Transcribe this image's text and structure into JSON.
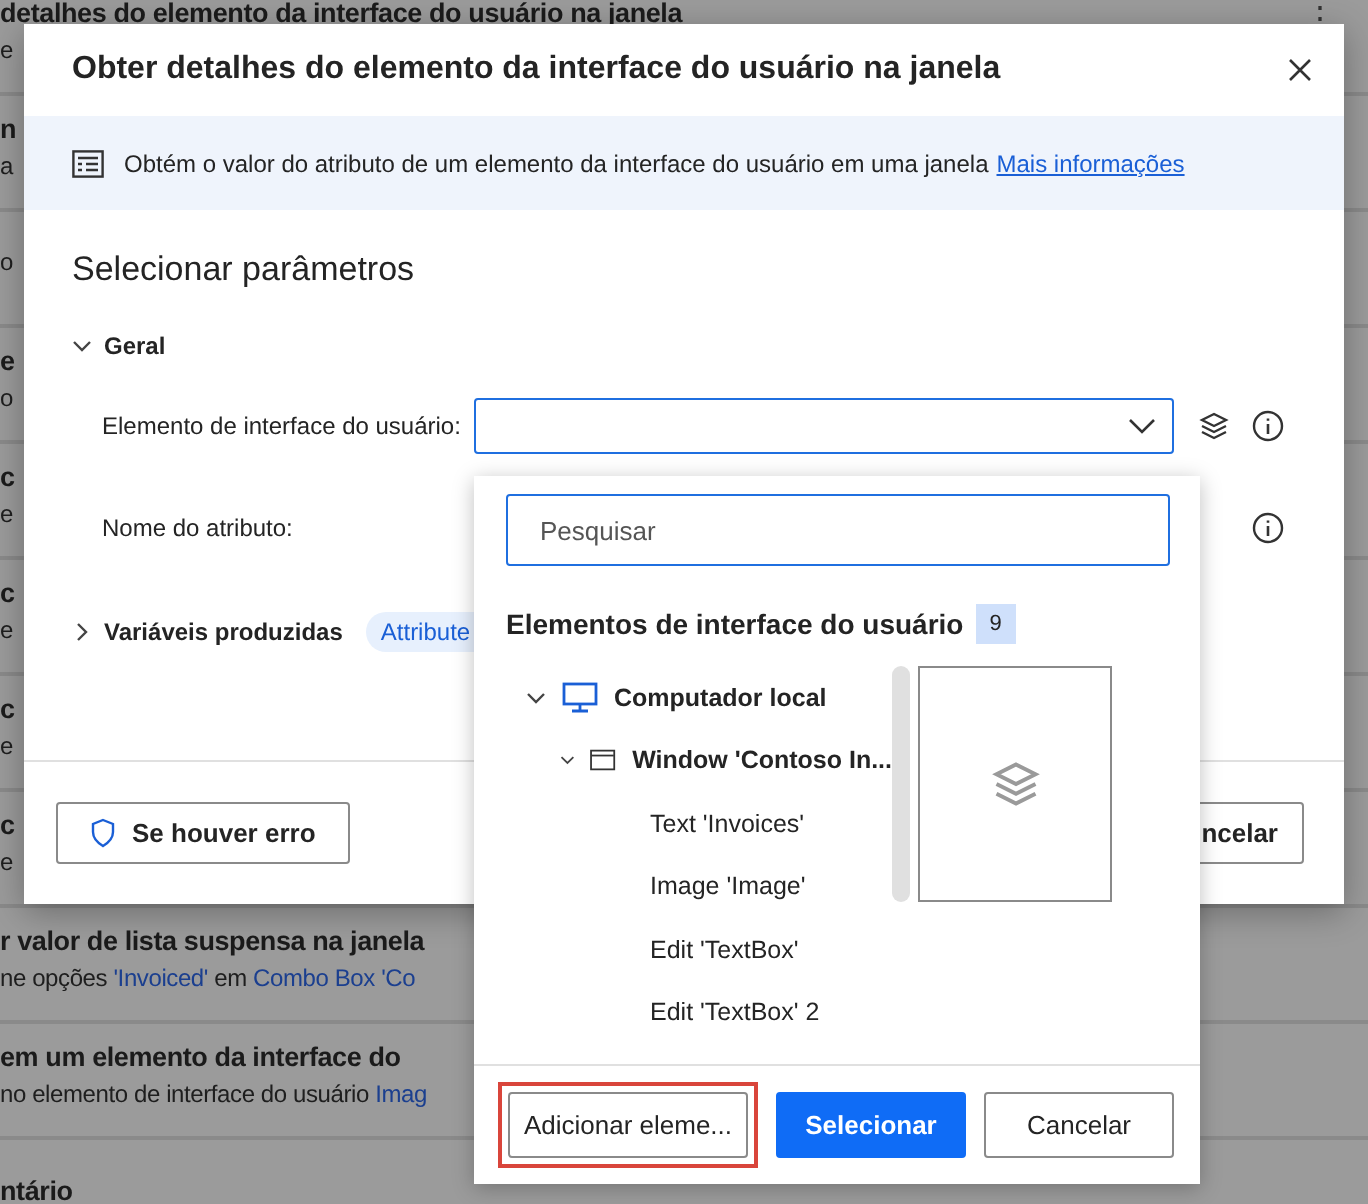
{
  "background_flow": {
    "menu_glyph": "⋮",
    "cards": [
      {
        "title": "detalhes do elemento da interface do usuário na janela",
        "subtitle": [
          {
            "text": "e",
            "kind": "text"
          }
        ]
      },
      {
        "title": "n",
        "subtitle": [
          {
            "text": "a",
            "kind": "text"
          }
        ]
      },
      {
        "subtitle": [
          {
            "text": "o",
            "kind": "text"
          }
        ]
      },
      {
        "title": "e",
        "subtitle": [
          {
            "text": "o",
            "kind": "text"
          }
        ]
      },
      {
        "title": "c",
        "subtitle": [
          {
            "text": "e",
            "kind": "text"
          }
        ]
      },
      {
        "title": "c",
        "subtitle": [
          {
            "text": "e",
            "kind": "text"
          }
        ]
      },
      {
        "title": "c",
        "subtitle": [
          {
            "text": "e",
            "kind": "text"
          }
        ]
      },
      {
        "title": "c",
        "subtitle": [
          {
            "text": "e",
            "kind": "text"
          }
        ]
      },
      {
        "title": "r valor de lista suspensa na janela",
        "subtitle": [
          {
            "text": "ne opções ",
            "kind": "text"
          },
          {
            "text": "'Invoiced'",
            "kind": "link"
          },
          {
            "text": " em ",
            "kind": "text"
          },
          {
            "text": "Combo Box 'Co",
            "kind": "link"
          }
        ]
      },
      {
        "title": "em um elemento da interface do",
        "subtitle": [
          {
            "text": "no elemento de interface do usuário ",
            "kind": "text"
          },
          {
            "text": "Imag",
            "kind": "link"
          }
        ]
      },
      {
        "title": "ntário"
      }
    ]
  },
  "dialog": {
    "title": "Obter detalhes do elemento da interface do usuário na janela",
    "description": "Obtém o valor do atributo de um elemento da interface do usuário em uma janela",
    "more_link": "Mais informações",
    "section_title": "Selecionar parâmetros",
    "groups": [
      {
        "label": "Geral",
        "expanded": true
      },
      {
        "label": "Variáveis produzidas",
        "expanded": false,
        "variable": "Attribute"
      }
    ],
    "fields": [
      {
        "kind": "dropdown",
        "label": "Elemento de interface do usuário:"
      },
      {
        "kind": "text",
        "label": "Nome do atributo:"
      }
    ],
    "buttons": [
      {
        "label": "Se houver erro",
        "kind": "error"
      },
      {
        "label": "ncelar",
        "kind": "cancel"
      }
    ]
  },
  "picker": {
    "search": {
      "placeholder": "Pesquisar"
    },
    "heading": "Elementos de interface do usuário",
    "count": "9",
    "tree": [
      {
        "label": "Computador local",
        "kind": "computer",
        "expanded": true,
        "children": [
          {
            "label": "Window 'Contoso In...",
            "kind": "window",
            "expanded": true,
            "children": [
              {
                "label": "Text 'Invoices'"
              },
              {
                "label": "Image 'Image'"
              },
              {
                "label": "Edit 'TextBox'"
              },
              {
                "label": "Edit 'TextBox' 2"
              }
            ]
          }
        ]
      }
    ],
    "buttons": [
      {
        "label": "Adicionar eleme...",
        "kind": "secondary",
        "highlighted": true
      },
      {
        "label": "Selecionar",
        "kind": "primary",
        "highlighted": false
      },
      {
        "label": "Cancelar",
        "kind": "secondary",
        "highlighted": false
      }
    ]
  }
}
